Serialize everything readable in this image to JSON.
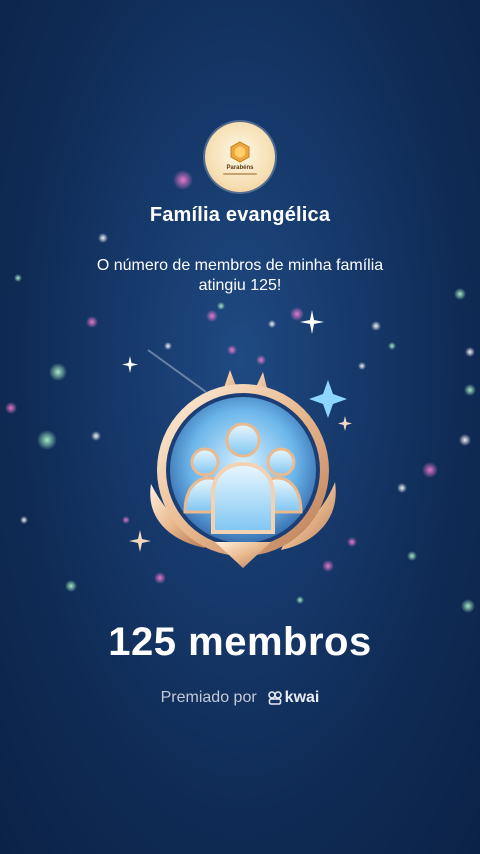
{
  "avatar": {
    "label": "Parabéns"
  },
  "group_name": "Família evangélica",
  "message_line1": "O número de membros de minha família",
  "message_line2": "atingiu 125!",
  "members_count": "125 membros",
  "awarded_by": "Premiado por",
  "brand": "kwai",
  "colors": {
    "background": "#16386a",
    "badge_gold": "#e9b98f",
    "badge_blue": "#7fc6f2"
  }
}
